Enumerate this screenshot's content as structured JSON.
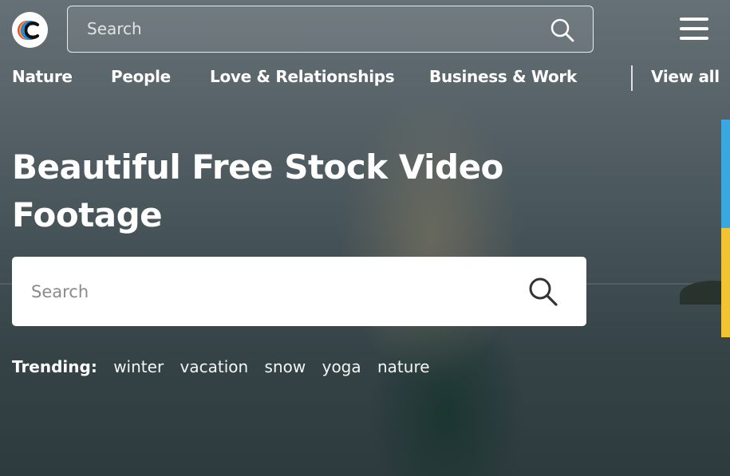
{
  "header": {
    "logo_icon": "c-rainbow-logo-icon",
    "search": {
      "placeholder": "Search",
      "value": ""
    },
    "search_icon": "search-icon",
    "menu_icon": "hamburger-menu-icon"
  },
  "categories": {
    "items": [
      "Nature",
      "People",
      "Love & Relationships",
      "Business & Work"
    ],
    "view_all": "View all"
  },
  "hero": {
    "title_line1": "Beautiful Free Stock Video",
    "title_line2": "Footage",
    "search": {
      "placeholder": "Search",
      "value": ""
    },
    "search_icon": "search-icon"
  },
  "trending": {
    "label": "Trending:",
    "tags": [
      "winter",
      "vacation",
      "snow",
      "yoga",
      "nature"
    ]
  },
  "colors": {
    "accent_blue": "#39a8e0",
    "accent_yellow": "#f2c431",
    "logo_red": "#e8423c",
    "logo_orange": "#f5a623",
    "logo_blue": "#1e88e5"
  }
}
